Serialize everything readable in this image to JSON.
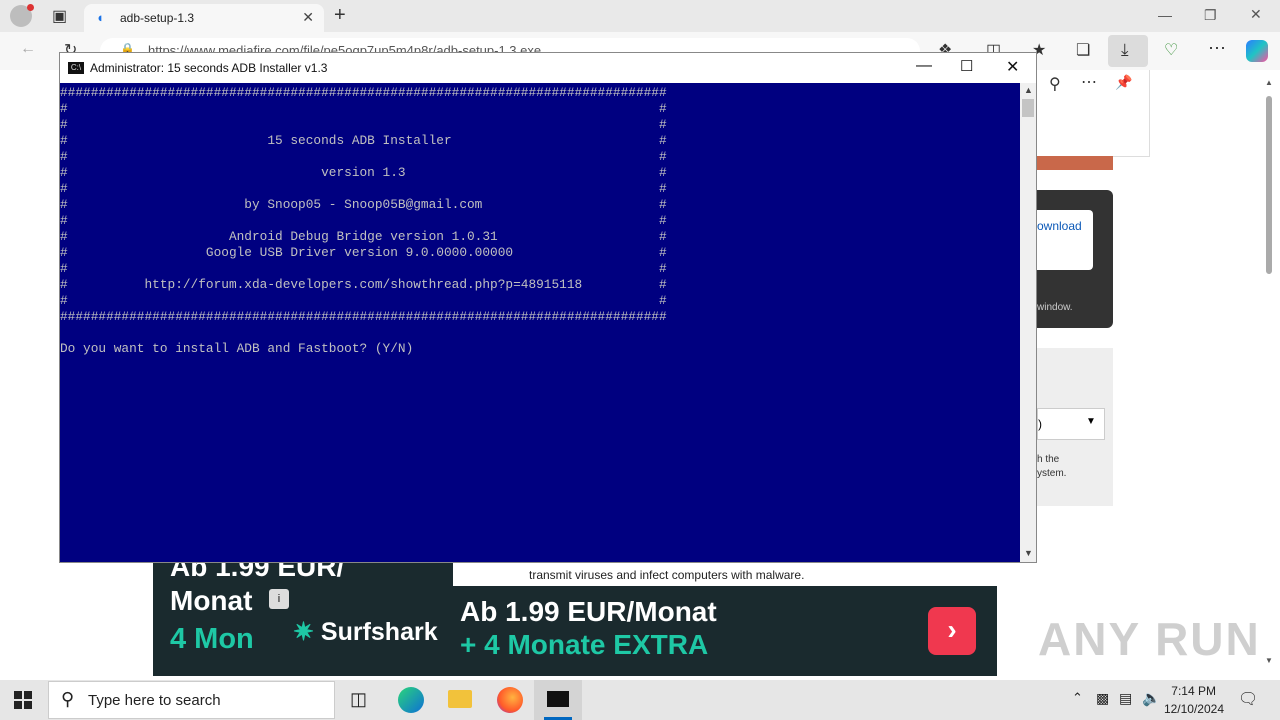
{
  "browser": {
    "tab_title": "adb-setup-1.3",
    "address": "https://www.mediafire.com/file/pe5oqp7up5m4p8r/adb-setup-1.3.exe"
  },
  "page": {
    "download_label": "ownload",
    "window_text": "window.",
    "select_value": ")",
    "grey_text_line1": "h the",
    "grey_text_line2": "ystem.",
    "warning_text": "transmit viruses and infect computers with malware."
  },
  "ad": {
    "left_line1": "Ab 1.99 EUR/",
    "left_line2": "Monat",
    "left_line3": "4 Mon",
    "brand": "Surfshark",
    "headline1": "Ab 1.99 EUR/Monat",
    "headline2": "+ 4 Monate EXTRA",
    "cta_glyph": "›",
    "info_glyph": "i"
  },
  "watermark": "ANY RUN",
  "console_window": {
    "title": "Administrator:  15 seconds ADB Installer v1.3",
    "icon_text": "C:\\",
    "lines": [
      "###############################################################################",
      "#                                                                             #",
      "#                                                                             #",
      "#                          15 seconds ADB Installer                           #",
      "#                                                                             #",
      "#                                 version 1.3                                 #",
      "#                                                                             #",
      "#                       by Snoop05 - Snoop05B@gmail.com                       #",
      "#                                                                             #",
      "#                     Android Debug Bridge version 1.0.31                     #",
      "#                  Google USB Driver version 9.0.0000.00000                   #",
      "#                                                                             #",
      "#          http://forum.xda-developers.com/showthread.php?p=48915118          #",
      "#                                                                             #",
      "###############################################################################",
      "",
      "Do you want to install ADB and Fastboot? (Y/N)"
    ]
  },
  "taskbar": {
    "search_placeholder": "Type here to search",
    "time": "7:14 PM",
    "date": "12/10/2024"
  }
}
